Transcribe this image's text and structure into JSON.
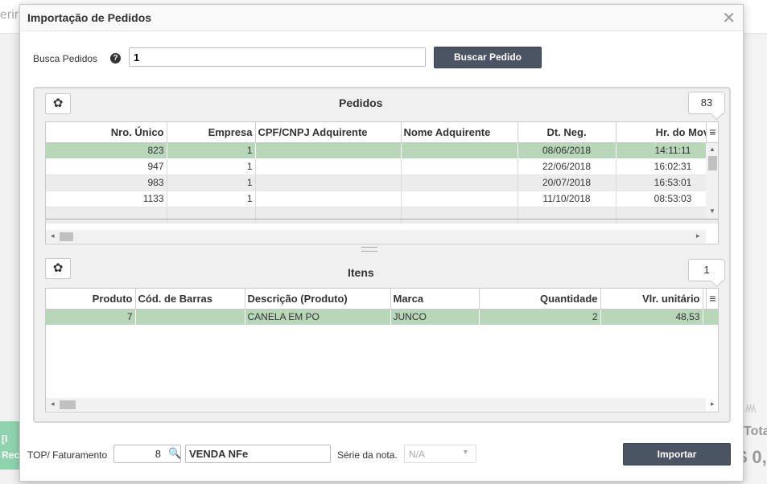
{
  "background": {
    "left_fragment": "erir",
    "green_button_label": "[I",
    "green_button_sublabel": "Rec",
    "total_label": "Tota",
    "total_value": "$ 0,"
  },
  "modal": {
    "title": "Importação de Pedidos",
    "close_icon": "close-icon"
  },
  "search": {
    "label": "Busca Pedidos",
    "help_icon": "question-circle-icon",
    "value": "1",
    "button_label": "Buscar Pedido"
  },
  "orders": {
    "title": "Pedidos",
    "count": "83",
    "columns": [
      "Nro. Único",
      "Empresa",
      "CPF/CNPJ Adquirente",
      "Nome Adquirente",
      "Dt. Neg.",
      "Hr. do Movime"
    ],
    "rows": [
      [
        "823",
        "1",
        "",
        "",
        "08/06/2018",
        "14:11:11"
      ],
      [
        "947",
        "1",
        "",
        "",
        "22/06/2018",
        "16:02:31"
      ],
      [
        "983",
        "1",
        "",
        "",
        "20/07/2018",
        "16:53:01"
      ],
      [
        "1133",
        "1",
        "",
        "",
        "11/10/2018",
        "08:53:03"
      ]
    ]
  },
  "items": {
    "title": "Itens",
    "count": "1",
    "columns": [
      "Produto",
      "Cód. de Barras",
      "Descrição (Produto)",
      "Marca",
      "Quantidade",
      "Vlr. unitário"
    ],
    "rows": [
      [
        "7",
        "",
        "CANELA EM PO",
        "JUNCO",
        "2",
        "48,53"
      ]
    ]
  },
  "footer": {
    "top_label": "TOP/ Faturamento",
    "top_code": "8",
    "top_desc": "VENDA NFe",
    "serie_label": "Série da nota.",
    "serie_value": "N/A",
    "import_button": "Importar"
  },
  "colors": {
    "selected_row": "#b7d7b8",
    "button_dark": "#4a5462",
    "accent_green": "#8fd3ae"
  }
}
